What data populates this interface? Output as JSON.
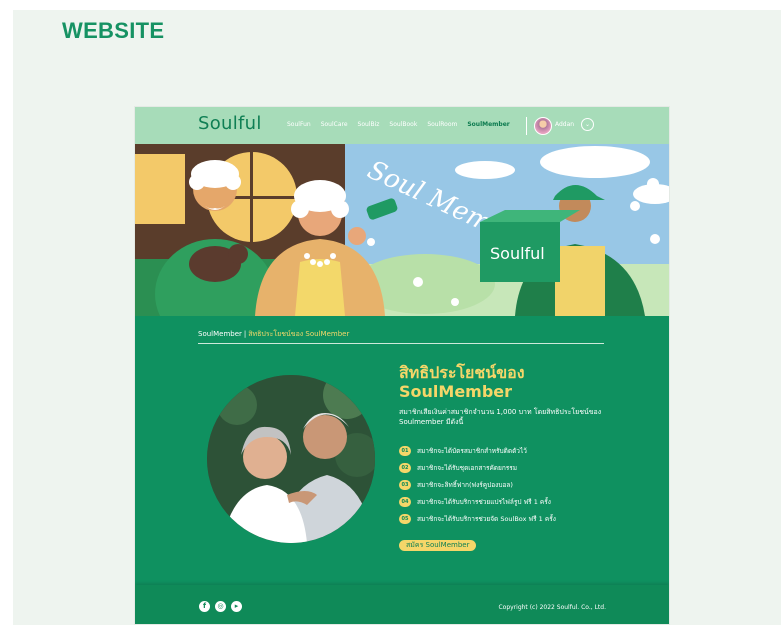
{
  "header": {
    "title": "WEBSITE"
  },
  "nav": {
    "logo": "Soulful",
    "items": [
      "SoulFun",
      "SoulCare",
      "SoulBiz",
      "SoulBook",
      "SoulRoom",
      "SoulMember"
    ],
    "active_item": "SoulMember",
    "user_name": "Addan",
    "chevron": "⌄"
  },
  "hero": {
    "script_text": "Soul Member",
    "box_label": "Soulful"
  },
  "breadcrumb": {
    "root": "SoulMember",
    "separator": "|",
    "current": "สิทธิประโยชน์ของ SoulMember"
  },
  "main": {
    "title_line1": "สิทธิประโยชน์ของ",
    "title_line2": "SoulMember",
    "description": "สมาชิกเสียเงินค่าสมาชิกจำนวน 1,000 บาท โดยสิทธิประโยชน์ของ Soulmember มีดังนี้",
    "benefits": [
      {
        "num": "01",
        "text": "สมาชิกจะได้บัตรสมาชิกสำหรับติดตัวไว้"
      },
      {
        "num": "02",
        "text": "สมาชิกจะได้รับชุดเอกสารคัดยกรรม"
      },
      {
        "num": "03",
        "text": "สมาชิกจะลิทธิ์ฟาก(ฟงร์คูปองบอล)"
      },
      {
        "num": "04",
        "text": "สมาชิกจะได้รับบริการช่วยแปรไฟล์รูป ฟรี 1 ครั้ง"
      },
      {
        "num": "05",
        "text": "สมาชิกจะได้รับบริการช่วยจัด SoulBox ฟรี 1 ครั้ง"
      }
    ],
    "apply_button": "สมัคร SoulMember"
  },
  "footer": {
    "social": [
      "f",
      "◎",
      "▸"
    ],
    "copyright": "Copyright (c) 2022 Soulful. Co., Ltd."
  },
  "colors": {
    "brand_green": "#0f9160",
    "mint_nav": "#a7dcb9",
    "accent_yellow": "#f5d669"
  }
}
